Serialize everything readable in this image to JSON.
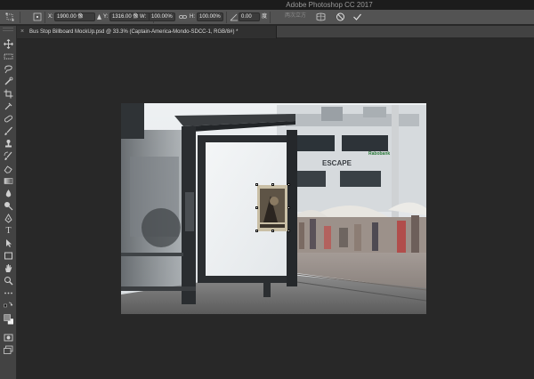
{
  "window": {
    "title": "Adobe Photoshop CC 2017"
  },
  "options": {
    "x_label": "X:",
    "x_value": "1900.00 像",
    "y_label": "Y:",
    "y_value": "1316.00 像",
    "w_label": "W:",
    "w_value": "100.00%",
    "h_label": "H:",
    "h_value": "100.00%",
    "angle_value": "0.00",
    "angle_unit": "度",
    "interp_value": "两次立方",
    "icons": [
      "reference-point-icon",
      "link-icon",
      "angle-icon",
      "warp-icon",
      "cancel-icon",
      "commit-icon"
    ]
  },
  "document": {
    "tab_label": "Bus Stop Billboard MockUp.psd @ 33.3% (Captain-America-Mondo-SDCC-1, RGB/8#) *",
    "close_glyph": "×"
  },
  "toolbar": {
    "tools": [
      "move",
      "marquee",
      "lasso",
      "quick-select",
      "crop",
      "eyedropper",
      "healing",
      "brush",
      "stamp",
      "history-brush",
      "eraser",
      "gradient",
      "blur",
      "dodge",
      "pen",
      "type",
      "path-select",
      "shape",
      "hand",
      "zoom",
      "more",
      "swap-colors",
      "colors",
      "quick-mask",
      "screen-mode"
    ]
  },
  "colors": {
    "accent": "#ffffff",
    "bg": "#282828",
    "panel": "#434343"
  }
}
